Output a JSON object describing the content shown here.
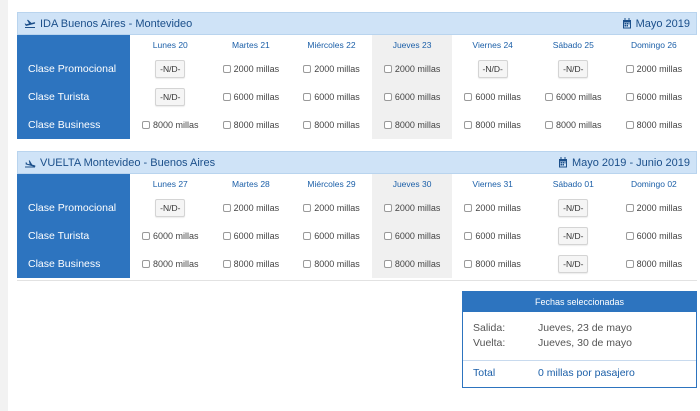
{
  "ida": {
    "title": "IDA Buenos Aires - Montevideo",
    "month": "Mayo 2019",
    "days": [
      "Lunes 20",
      "Martes 21",
      "Miércoles 22",
      "Jueves 23",
      "Viernes 24",
      "Sábado 25",
      "Domingo 26"
    ],
    "rows": [
      {
        "label": "Clase Promocional",
        "cells": [
          "-N/D-",
          "2000 millas",
          "2000 millas",
          "2000 millas",
          "-N/D-",
          "-N/D-",
          "2000 millas"
        ]
      },
      {
        "label": "Clase Turista",
        "cells": [
          "-N/D-",
          "6000 millas",
          "6000 millas",
          "6000 millas",
          "6000 millas",
          "6000 millas",
          "6000 millas"
        ]
      },
      {
        "label": "Clase Business",
        "cells": [
          "8000 millas",
          "8000 millas",
          "8000 millas",
          "8000 millas",
          "8000 millas",
          "8000 millas",
          "8000 millas"
        ]
      }
    ]
  },
  "vuelta": {
    "title": "VUELTA Montevideo - Buenos Aires",
    "month": "Mayo 2019 - Junio 2019",
    "days": [
      "Lunes 27",
      "Martes 28",
      "Miércoles 29",
      "Jueves 30",
      "Viernes 31",
      "Sábado 01",
      "Domingo 02"
    ],
    "rows": [
      {
        "label": "Clase Promocional",
        "cells": [
          "-N/D-",
          "2000 millas",
          "2000 millas",
          "2000 millas",
          "2000 millas",
          "-N/D-",
          "2000 millas"
        ]
      },
      {
        "label": "Clase Turista",
        "cells": [
          "6000 millas",
          "6000 millas",
          "6000 millas",
          "6000 millas",
          "6000 millas",
          "-N/D-",
          "6000 millas"
        ]
      },
      {
        "label": "Clase Business",
        "cells": [
          "8000 millas",
          "8000 millas",
          "8000 millas",
          "8000 millas",
          "8000 millas",
          "-N/D-",
          "8000 millas"
        ]
      }
    ]
  },
  "highlight_day_index": 3,
  "summary": {
    "header": "Fechas seleccionadas",
    "salida_label": "Salida:",
    "salida_value": "Jueves, 23 de mayo",
    "vuelta_label": "Vuelta:",
    "vuelta_value": "Jueves, 30 de mayo",
    "total_label": "Total",
    "total_value": "0 millas por pasajero"
  },
  "colors": {
    "accent": "#2d74bf",
    "header_bg": "#cfe3f7",
    "highlight": "#f0f0f0"
  },
  "icons": {
    "ida": "plane-takeoff-icon",
    "vuelta": "plane-landing-icon",
    "calendar": "calendar-icon"
  }
}
